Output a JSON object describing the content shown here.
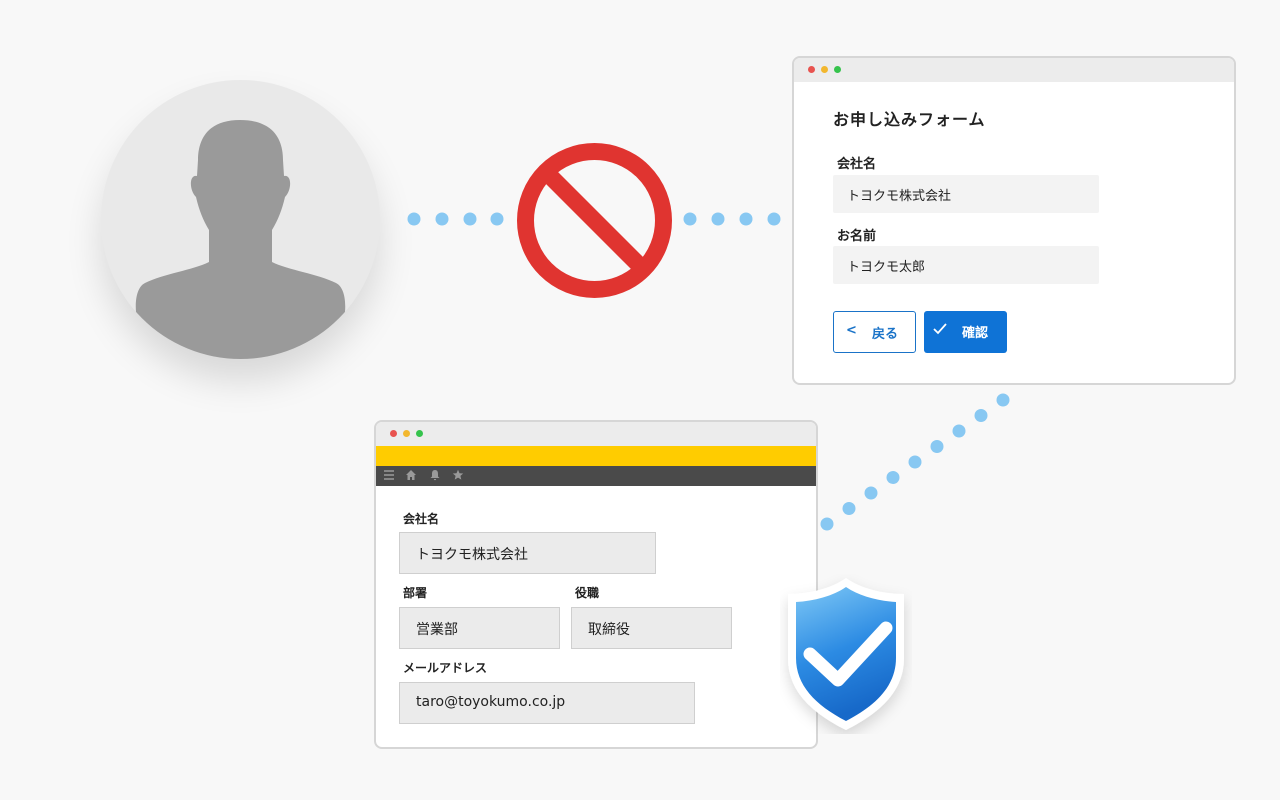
{
  "colors": {
    "background": "#f8f8f8",
    "dot": "#88c8f2",
    "prohibited": "#e03430",
    "primary": "#0f73d6",
    "header_yellow": "#ffcc00",
    "header_dark": "#4a4a4a",
    "shield": "#2c8be3"
  },
  "icons": {
    "user": "person-silhouette-icon",
    "prohibited": "no-entry-icon",
    "shield": "shield-check-icon"
  },
  "form_window": {
    "title": "お申し込みフォーム",
    "company_label": "会社名",
    "company_value": "トヨクモ株式会社",
    "name_label": "お名前",
    "name_value": "トヨクモ太郎",
    "back_button": "戻る",
    "back_icon": "<",
    "confirm_button": "確認",
    "confirm_icon": "checkmark-icon"
  },
  "app_window": {
    "toolbar_icons": [
      "menu-icon",
      "home-icon",
      "bell-icon",
      "star-icon"
    ],
    "company_label": "会社名",
    "company_value": "トヨクモ株式会社",
    "department_label": "部署",
    "department_value": "営業部",
    "title_label": "役職",
    "title_value": "取締役",
    "email_label": "メールアドレス",
    "email_value": "taro@toyokumo.co.jp"
  }
}
